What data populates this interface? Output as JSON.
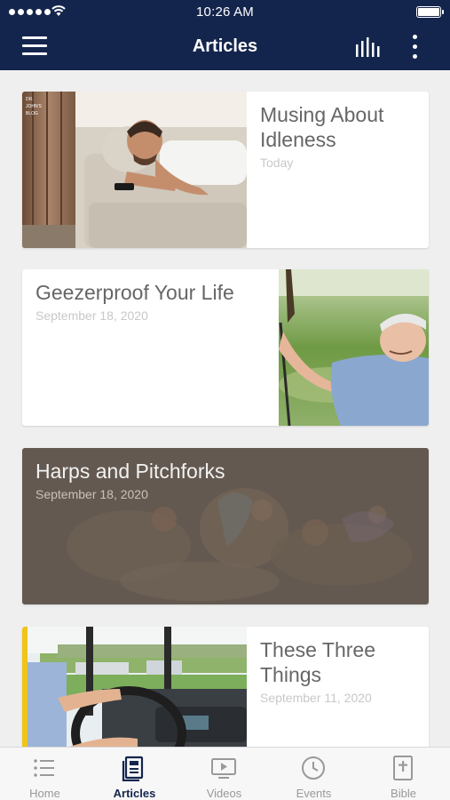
{
  "status_bar": {
    "time": "10:26 AM"
  },
  "header": {
    "title": "Articles"
  },
  "articles": [
    {
      "title": "Musing About Idleness",
      "date": "Today",
      "image_watermark": "DR. JOHN'S BLOG"
    },
    {
      "title": "Geezerproof Your Life",
      "date": "September 18, 2020"
    },
    {
      "title": "Harps and Pitchforks",
      "date": "September 18, 2020"
    },
    {
      "title": "These Three Things",
      "date": "September 11, 2020"
    }
  ],
  "tabs": [
    {
      "label": "Home",
      "icon": "list-icon",
      "active": false
    },
    {
      "label": "Articles",
      "icon": "article-icon",
      "active": true
    },
    {
      "label": "Videos",
      "icon": "video-icon",
      "active": false
    },
    {
      "label": "Events",
      "icon": "clock-icon",
      "active": false
    },
    {
      "label": "Bible",
      "icon": "bible-icon",
      "active": false
    }
  ],
  "colors": {
    "nav_bg": "#14254d",
    "active_tab": "#14254d",
    "inactive_tab": "#999999",
    "accent_yellow": "#f0c419"
  }
}
